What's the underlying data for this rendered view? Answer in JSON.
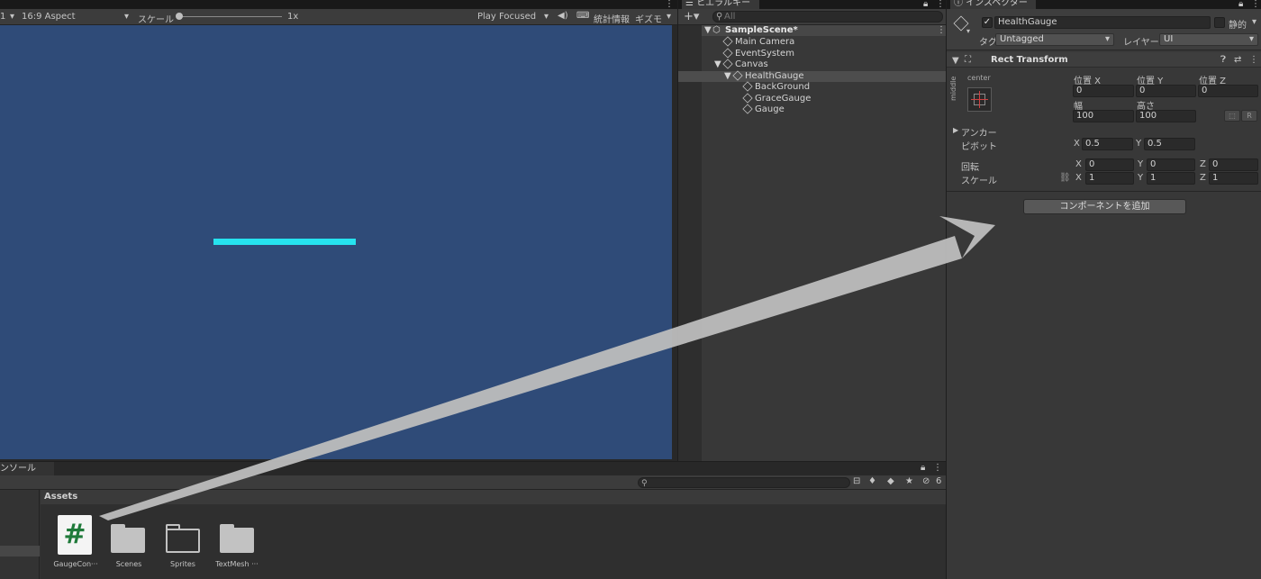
{
  "game_view": {
    "toolbar": {
      "display_number": "1",
      "aspect": "16:9 Aspect",
      "scale_label": "スケール",
      "scale_value": "1x",
      "play_mode": "Play Focused",
      "stats": "統計情報",
      "gizmos": "ギズモ"
    },
    "background_color": "#2f4b78",
    "gauge_color": "#26e3ef"
  },
  "hierarchy": {
    "tab_label": "ヒエラルキー",
    "search_placeholder": "All",
    "scene_name": "SampleScene*",
    "items": [
      {
        "label": "Main Camera"
      },
      {
        "label": "EventSystem"
      },
      {
        "label": "Canvas"
      },
      {
        "label": "HealthGauge"
      },
      {
        "label": "BackGround"
      },
      {
        "label": "GraceGauge"
      },
      {
        "label": "Gauge"
      }
    ]
  },
  "inspector": {
    "tab_label": "インスペクター",
    "object_name": "HealthGauge",
    "static_label": "静的",
    "tag_label": "タグ",
    "tag_value": "Untagged",
    "layer_label": "レイヤー",
    "layer_value": "UI",
    "component_title": "Rect Transform",
    "anchor_preset_top": "center",
    "anchor_preset_side": "middle",
    "pos_x_label": "位置 X",
    "pos_y_label": "位置 Y",
    "pos_z_label": "位置 Z",
    "pos_x": "0",
    "pos_y": "0",
    "pos_z": "0",
    "width_label": "幅",
    "height_label": "高さ",
    "width": "100",
    "height": "100",
    "r_button": "R",
    "anchor_label": "アンカー",
    "pivot_label": "ピボット",
    "pivot_x": "0.5",
    "pivot_y": "0.5",
    "rotation_label": "回転",
    "rot_x": "0",
    "rot_y": "0",
    "rot_z": "0",
    "scale_label": "スケール",
    "scale_x": "1",
    "scale_y": "1",
    "scale_z": "1",
    "axis_x": "X",
    "axis_y": "Y",
    "axis_z": "Z",
    "add_component": "コンポーネントを追加"
  },
  "bottom_panel": {
    "tab_label": "ンソール",
    "hidden_count": "6",
    "breadcrumb": "Assets",
    "assets": [
      {
        "label": "GaugeCon···",
        "type": "script"
      },
      {
        "label": "Scenes",
        "type": "folder"
      },
      {
        "label": "Sprites",
        "type": "folder-open"
      },
      {
        "label": "TextMesh ···",
        "type": "folder"
      }
    ]
  }
}
